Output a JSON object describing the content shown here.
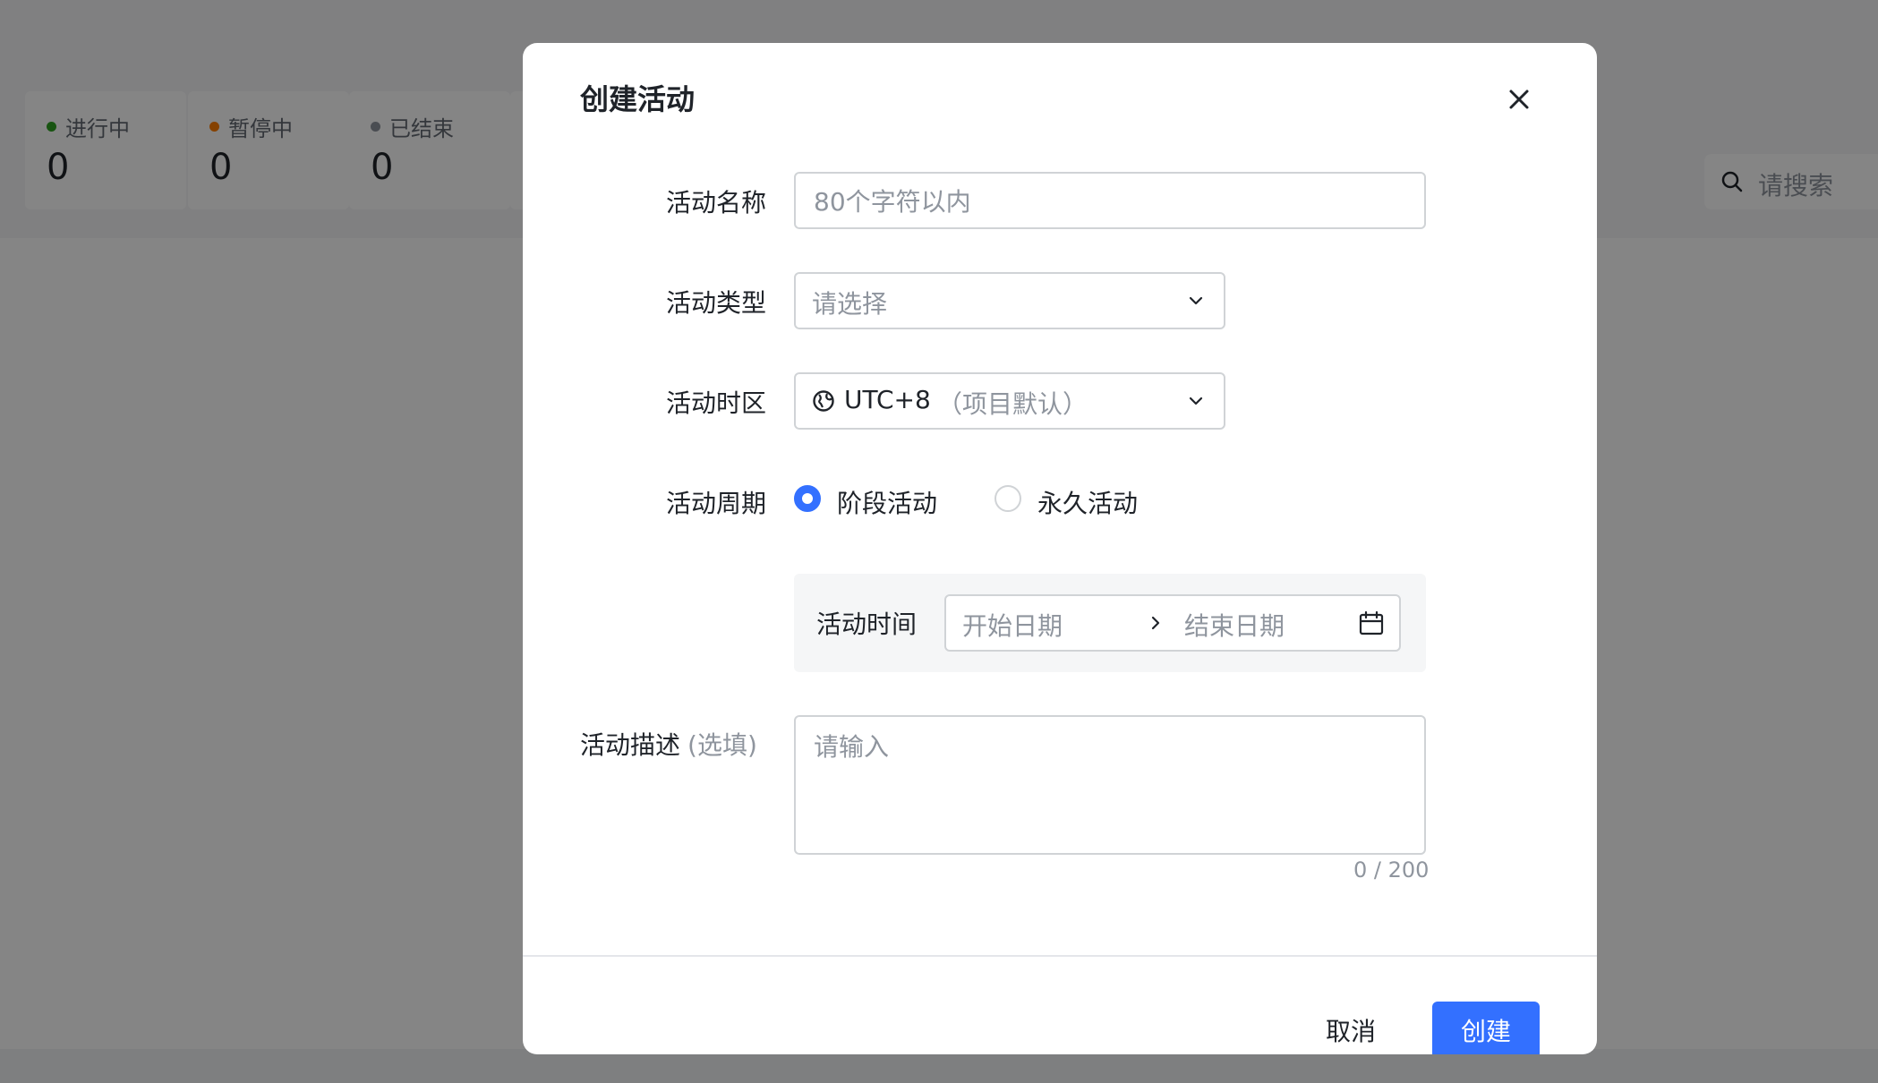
{
  "background": {
    "stats": [
      {
        "label": "进行中",
        "value": "0",
        "dot_color": "#2ea121"
      },
      {
        "label": "暂停中",
        "value": "0",
        "dot_color": "#ff7d00"
      },
      {
        "label": "已结束",
        "value": "0",
        "dot_color": "#8f959e"
      }
    ],
    "search": {
      "placeholder": "请搜索",
      "icon": "search-icon"
    }
  },
  "dialog": {
    "title": "创建活动",
    "close_icon": "close-icon",
    "fields": {
      "name": {
        "label": "活动名称",
        "placeholder": "80个字符以内",
        "value": ""
      },
      "type": {
        "label": "活动类型",
        "placeholder": "请选择",
        "icon": "chevron-down-icon"
      },
      "timezone": {
        "label": "活动时区",
        "value": "UTC+8",
        "hint": "（项目默认）",
        "icon": "globe-icon"
      },
      "period": {
        "label": "活动周期",
        "options": [
          {
            "label": "阶段活动",
            "selected": true
          },
          {
            "label": "永久活动",
            "selected": false
          }
        ]
      },
      "time": {
        "label": "活动时间",
        "start_placeholder": "开始日期",
        "end_placeholder": "结束日期",
        "separator_icon": "chevron-right-icon",
        "calendar_icon": "calendar-icon"
      },
      "description": {
        "label": "活动描述",
        "optional": "(选填)",
        "placeholder": "请输入",
        "counter": "0 / 200"
      }
    },
    "footer": {
      "cancel_label": "取消",
      "create_label": "创建"
    },
    "colors": {
      "primary": "#3370ff",
      "border": "#d0d3d6",
      "placeholder": "#8f959e",
      "panel": "#f5f6f7"
    }
  }
}
